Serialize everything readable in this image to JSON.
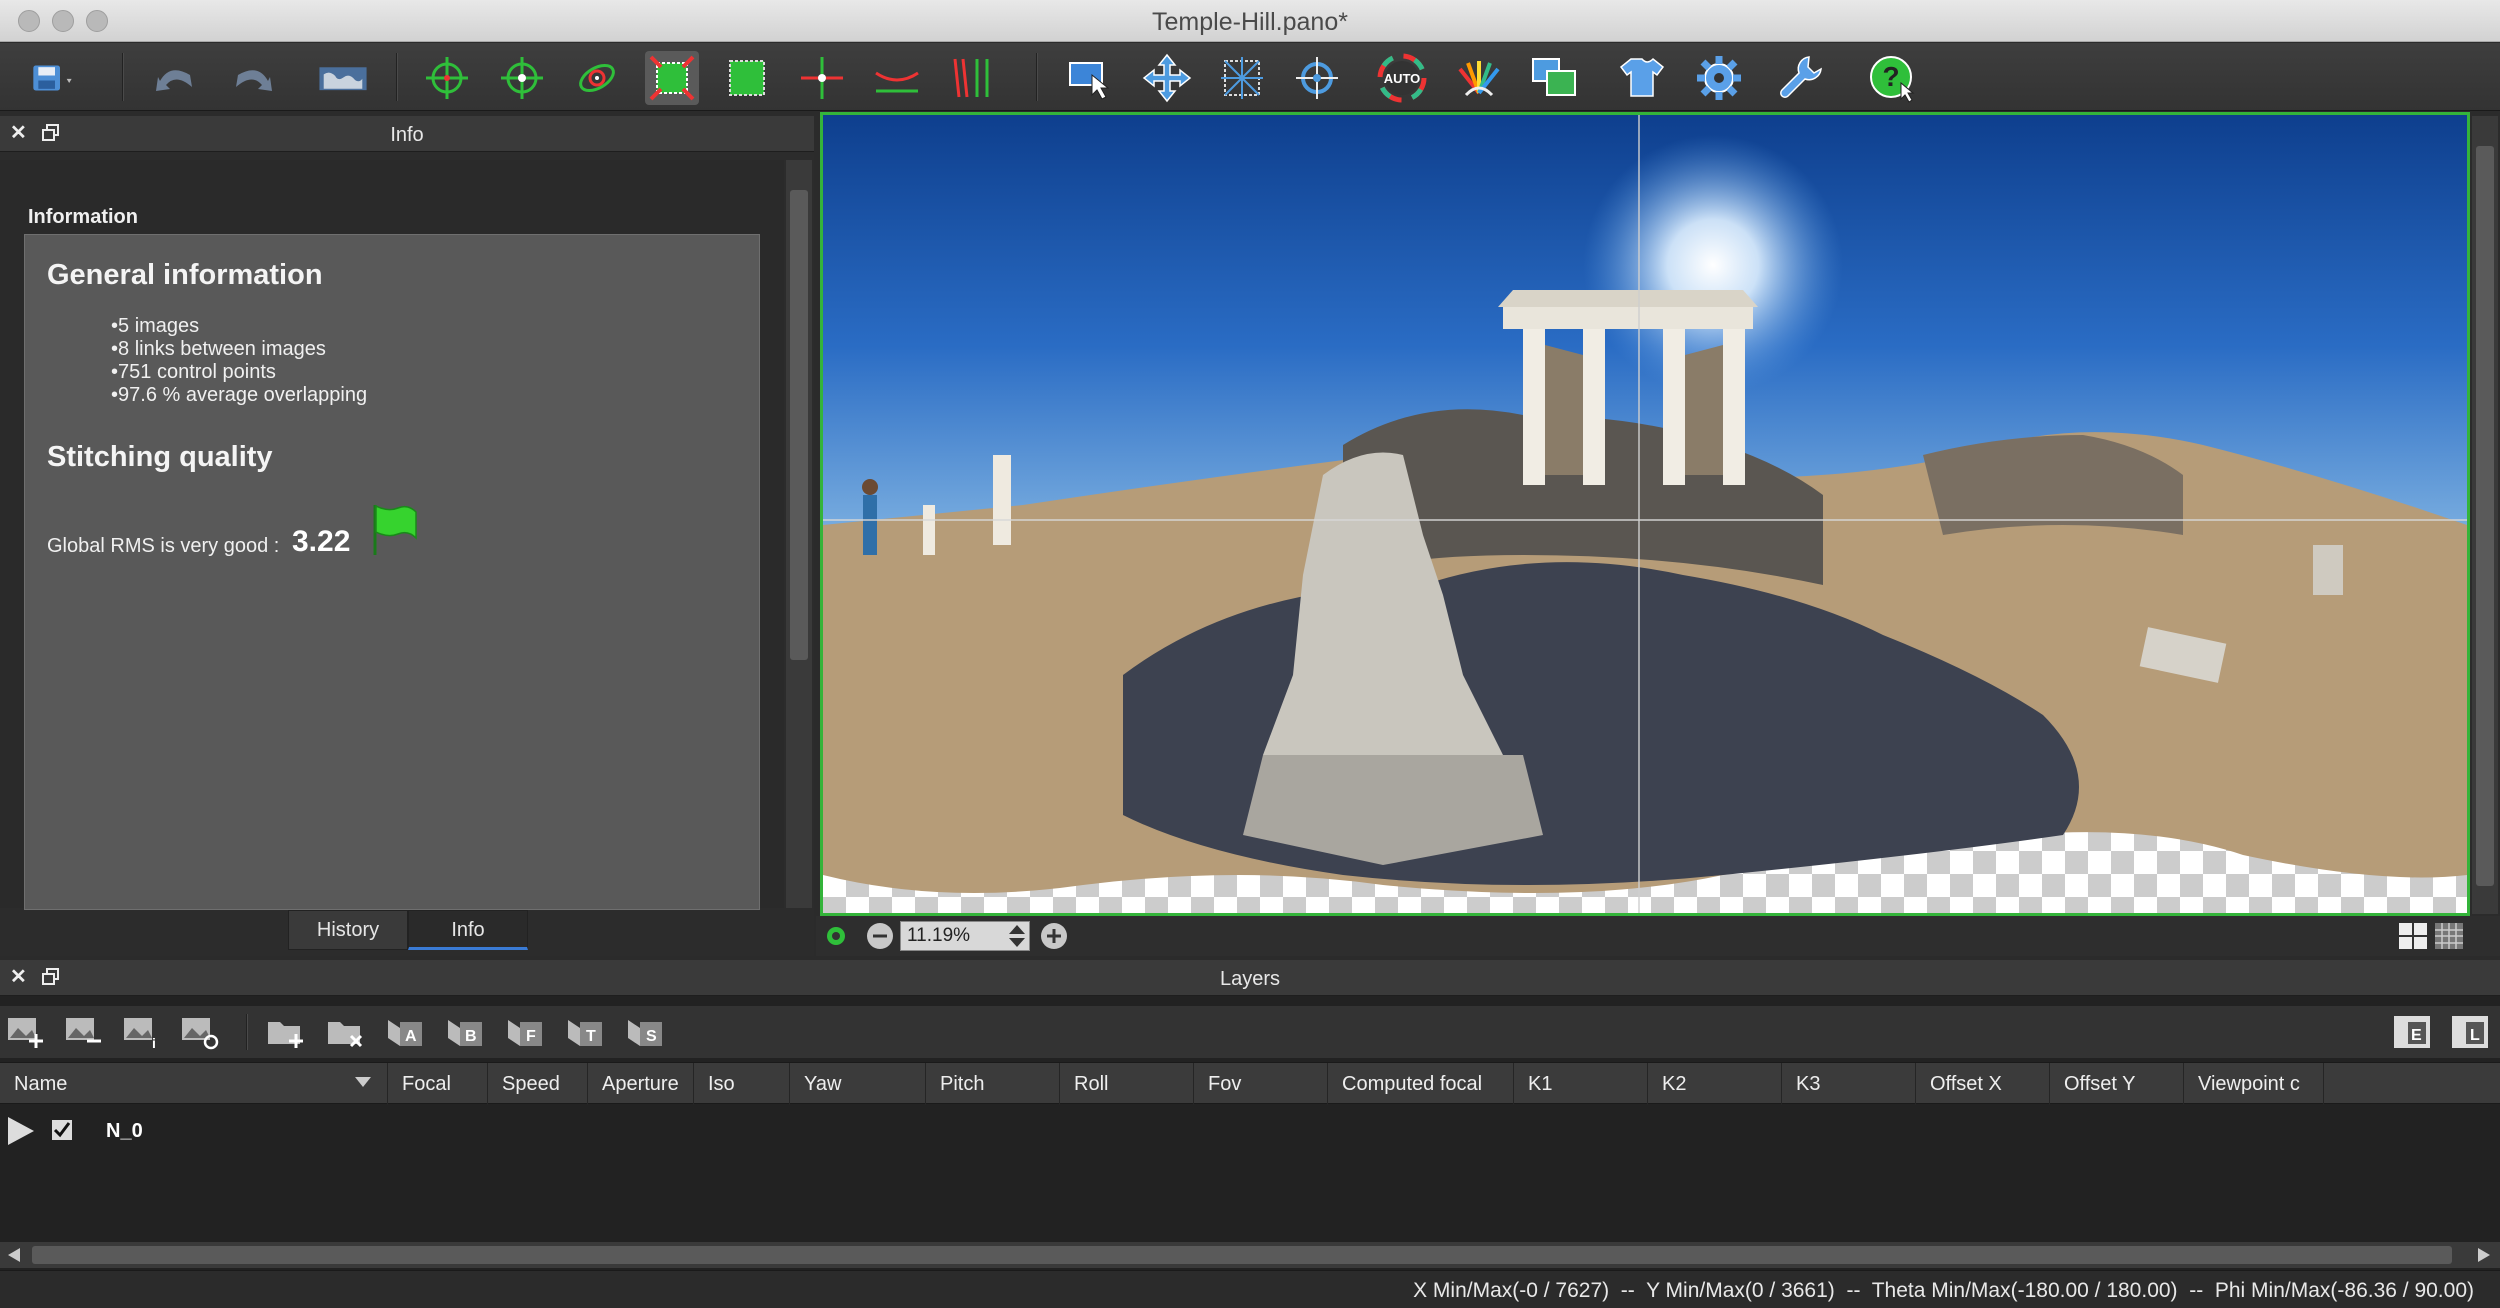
{
  "window": {
    "title": "Temple-Hill.pano*"
  },
  "info_panel": {
    "title": "Info",
    "section_label": "Information",
    "general_heading": "General information",
    "general_items": [
      "5 images",
      "8 links between images",
      "751 control points",
      "97.6 % average overlapping"
    ],
    "quality_heading": "Stitching quality",
    "rms_text": "Global RMS is very good :",
    "rms_value": "3.22",
    "tabs": [
      {
        "label": "History"
      },
      {
        "label": "Info"
      }
    ],
    "selected_tab": "Info"
  },
  "viewer": {
    "zoom": "11.19%"
  },
  "layers_panel": {
    "title": "Layers",
    "columns": [
      "Name",
      "Focal",
      "Speed",
      "Aperture",
      "Iso",
      "Yaw",
      "Pitch",
      "Roll",
      "Fov",
      "Computed focal",
      "K1",
      "K2",
      "K3",
      "Offset X",
      "Offset Y",
      "Viewpoint c"
    ],
    "rows": [
      {
        "name": "N_0",
        "checked": true
      }
    ]
  },
  "status": {
    "text": "X Min/Max(-0 / 7627)  --  Y Min/Max(0 / 3661)  --  Theta Min/Max(-180.00 / 180.00)  --  Phi Min/Max(-86.36 / 90.00)"
  },
  "colors": {
    "accent_green": "#34b43a",
    "tab_underline": "#3a7bd5"
  },
  "icons": {
    "toolbar": [
      "save-icon",
      "undo-icon",
      "redo-icon",
      "world-map-icon",
      "control-point-icon",
      "control-point-add-icon",
      "orbit-icon",
      "fit-crop-icon",
      "crop-icon",
      "horizon-icon",
      "vertical-lines-icon",
      "straight-lines-icon",
      "select-icon",
      "move-icon",
      "grid-transform-icon",
      "target-icon",
      "auto-color-icon",
      "color-fan-icon",
      "images-icon",
      "shirt-icon",
      "gear-icon",
      "wrench-icon",
      "help-icon"
    ]
  }
}
